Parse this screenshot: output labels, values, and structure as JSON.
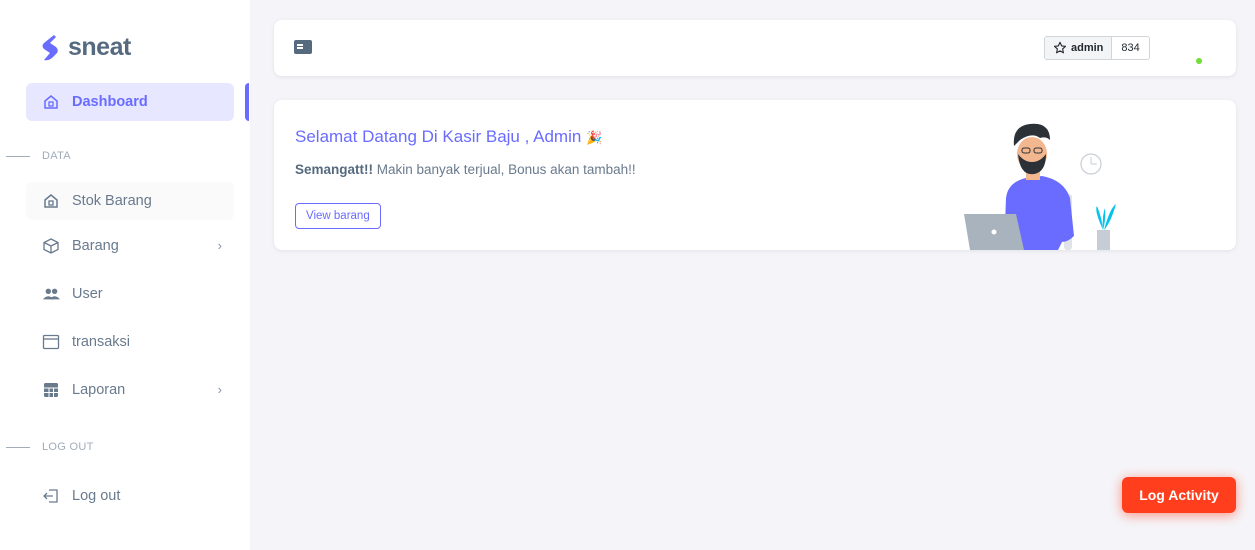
{
  "brand": {
    "name": "sneat",
    "color": "#696cff"
  },
  "sidebar": {
    "items": [
      {
        "label": "Dashboard",
        "icon": "home-icon",
        "active": true
      },
      {
        "label": "Stok Barang",
        "icon": "home-icon"
      },
      {
        "label": "Barang",
        "icon": "cube-icon",
        "submenu": true
      },
      {
        "label": "User",
        "icon": "users-icon"
      },
      {
        "label": "transaksi",
        "icon": "window-icon"
      },
      {
        "label": "Laporan",
        "icon": "table-icon",
        "submenu": true
      },
      {
        "label": "Log out",
        "icon": "logout-icon"
      }
    ],
    "headers": {
      "data": "DATA",
      "logout": "LOG OUT"
    }
  },
  "navbar": {
    "github_button": {
      "label": "admin",
      "count": "834",
      "icon": "star-icon"
    },
    "status": "online"
  },
  "welcome": {
    "title": "Selamat Datang Di Kasir Baju , Admin",
    "title_emoji": "🎉",
    "subtitle_bold": "Semangatt!!",
    "subtitle_rest": " Makin banyak terjual, Bonus akan tambah!!",
    "button": "View barang"
  },
  "floating_button": {
    "label": "Log Activity",
    "color": "#ff3e1d"
  }
}
